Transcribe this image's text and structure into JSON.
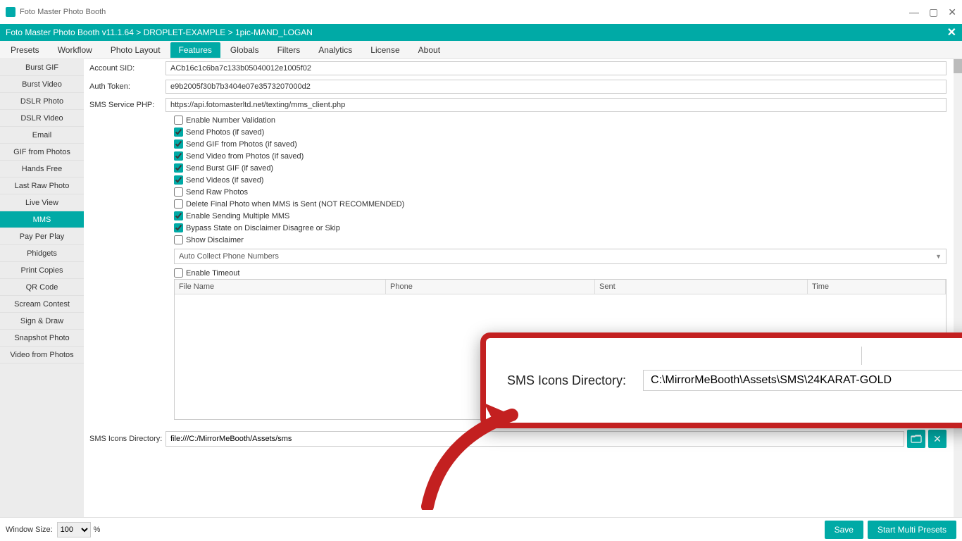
{
  "window_title": "Foto Master Photo Booth",
  "breadcrumb": "Foto Master Photo Booth v11.1.64 > DROPLET-EXAMPLE > 1pic-MAND_LOGAN",
  "tabs": [
    "Presets",
    "Workflow",
    "Photo Layout",
    "Features",
    "Globals",
    "Filters",
    "Analytics",
    "License",
    "About"
  ],
  "active_tab": "Features",
  "sidebar": [
    "Burst GIF",
    "Burst Video",
    "DSLR Photo",
    "DSLR Video",
    "Email",
    "GIF from Photos",
    "Hands Free",
    "Last Raw Photo",
    "Live View",
    "MMS",
    "Pay Per Play",
    "Phidgets",
    "Print Copies",
    "QR Code",
    "Scream Contest",
    "Sign & Draw",
    "Snapshot Photo",
    "Video from Photos"
  ],
  "active_side": "MMS",
  "fields": {
    "account_sid_label": "Account SID:",
    "account_sid": "ACb16c1c6ba7c133b05040012e1005f02",
    "auth_token_label": "Auth Token:",
    "auth_token": "e9b2005f30b7b3404e07e3573207000d2",
    "sms_php_label": "SMS Service PHP:",
    "sms_php": "https://api.fotomasterltd.net/texting/mms_client.php"
  },
  "checks": [
    {
      "label": "Enable Number Validation",
      "checked": false
    },
    {
      "label": "Send Photos (if saved)",
      "checked": true
    },
    {
      "label": "Send GIF from Photos (if saved)",
      "checked": true
    },
    {
      "label": "Send Video from Photos (if saved)",
      "checked": true
    },
    {
      "label": "Send Burst GIF (if saved)",
      "checked": true
    },
    {
      "label": "Send Videos (if saved)",
      "checked": true
    },
    {
      "label": "Send Raw Photos",
      "checked": false
    },
    {
      "label": "Delete Final Photo when MMS is Sent (NOT RECOMMENDED)",
      "checked": false
    },
    {
      "label": "Enable Sending Multiple MMS",
      "checked": true
    },
    {
      "label": "Bypass State on Disclaimer Disagree or Skip",
      "checked": true
    },
    {
      "label": "Show Disclaimer",
      "checked": false
    }
  ],
  "dropdown": "Auto Collect Phone Numbers",
  "enable_timeout": {
    "label": "Enable Timeout",
    "checked": false
  },
  "table_headers": {
    "file": "File Name",
    "phone": "Phone",
    "sent": "Sent",
    "time": "Time"
  },
  "icons_dir_label": "SMS Icons Directory:",
  "icons_dir_value": "file:///C:/MirrorMeBooth/Assets/sms",
  "bottom": {
    "window_size_label": "Window Size:",
    "window_size_value": "100",
    "pct": "%",
    "save": "Save",
    "start": "Start Multi Presets"
  },
  "callout": {
    "label": "SMS Icons Directory:",
    "value": "C:\\MirrorMeBooth\\Assets\\SMS\\24KARAT-GOLD"
  }
}
